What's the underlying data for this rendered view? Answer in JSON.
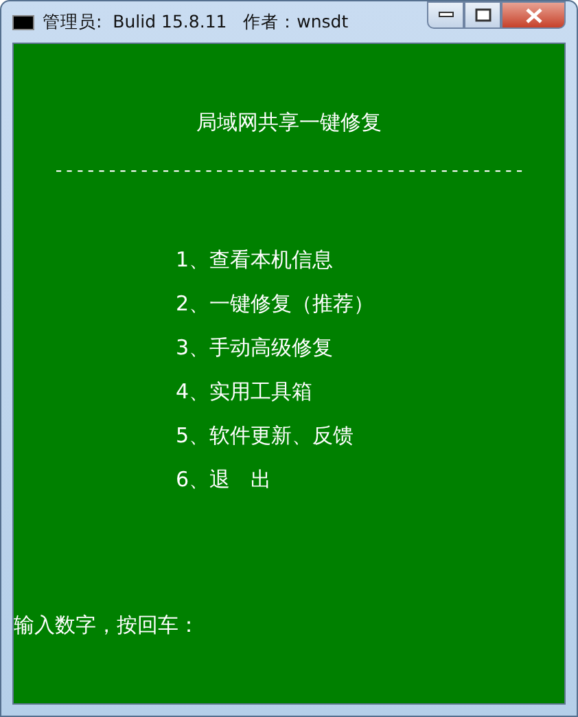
{
  "window": {
    "title": "管理员:  Bulid 15.8.11   作者：wnsdt"
  },
  "console": {
    "heading": "局域网共享一键修复",
    "separator": "--------------------------------------------",
    "menu_items": [
      "1、查看本机信息",
      "2、一键修复（推荐）",
      "3、手动高级修复",
      "4、实用工具箱",
      "5、软件更新、反馈",
      "6、退　出"
    ],
    "prompt": "输入数字，按回车："
  }
}
